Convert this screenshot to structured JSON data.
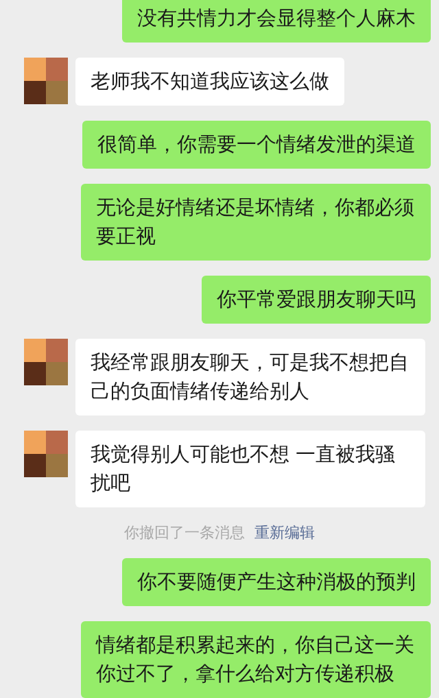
{
  "messages": [
    {
      "kind": "sent",
      "text": "没有共情力才会显得整个人麻木"
    },
    {
      "kind": "received",
      "text": "老师我不知道我应该这么做"
    },
    {
      "kind": "sent",
      "text": "很简单，你需要一个情绪发泄的渠道"
    },
    {
      "kind": "sent",
      "text": "无论是好情绪还是坏情绪，你都必须要正视"
    },
    {
      "kind": "sent",
      "text": "你平常爱跟朋友聊天吗"
    },
    {
      "kind": "received",
      "text": "我经常跟朋友聊天，可是我不想把自己的负面情绪传递给别人"
    },
    {
      "kind": "received",
      "text": "我觉得别人可能也不想 一直被我骚扰吧"
    },
    {
      "kind": "system",
      "text": "你撤回了一条消息",
      "action": "重新编辑"
    },
    {
      "kind": "sent",
      "text": "你不要随便产生这种消极的预判"
    },
    {
      "kind": "sent",
      "text": "情绪都是积累起来的，你自己这一关你过不了，拿什么给对方传递积极"
    }
  ]
}
